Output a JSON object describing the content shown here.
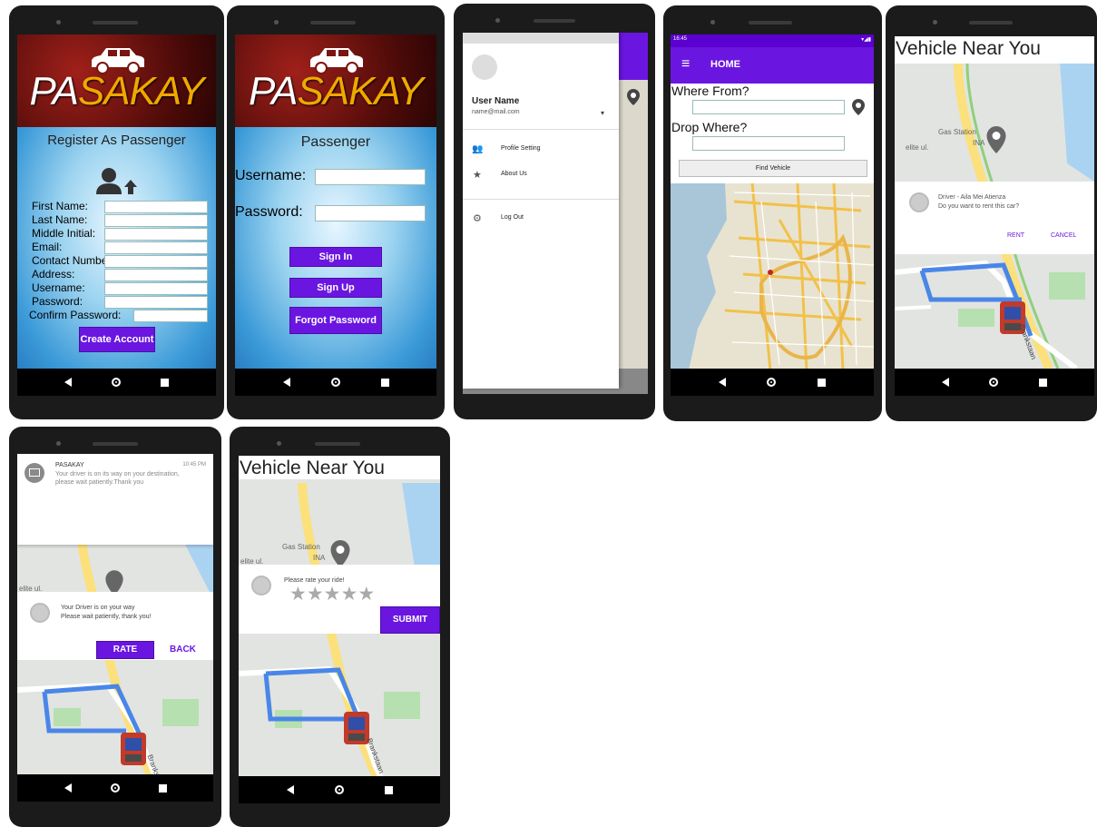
{
  "colors": {
    "accent": "#6a16e0",
    "purple_bar": "#6200ee",
    "gold": "#f0a800"
  },
  "brand": {
    "logo_part1": "PA",
    "logo_part2": "SAKAY"
  },
  "register": {
    "title": "Register As Passenger",
    "fields": [
      "First Name:",
      "Last Name:",
      "Middle Initial:",
      "Email:",
      "Contact Number:",
      "Address:",
      "Username:",
      "Password:",
      "Confirm Password:"
    ],
    "create_button": "Create Account"
  },
  "login": {
    "title": "Passenger",
    "username_label": "Username:",
    "password_label": "Password:",
    "sign_in": "Sign In",
    "sign_up": "Sign Up",
    "forgot": "Forgot Password"
  },
  "drawer": {
    "user_name": "User Name",
    "email": "name@mail.com",
    "items": [
      {
        "label": "Profile Setting",
        "icon": "people-icon"
      },
      {
        "label": "About Us",
        "icon": "star-icon"
      },
      {
        "label": "Log Out",
        "icon": "gear-icon"
      }
    ]
  },
  "home": {
    "status_time": "16:45",
    "title": "HOME",
    "where_from": "Where From?",
    "drop_where": "Drop Where?",
    "find_button": "Find Vehicle"
  },
  "vehicle": {
    "title": "Vehicle Near You",
    "driver_line": "Driver - Aila Mei Atienza",
    "question": "Do you want to rent this car?",
    "rent": "RENT",
    "cancel": "CANCEL",
    "map_labels": {
      "gas": "Gas Station",
      "ina": "INA",
      "street": "elite ul.",
      "road": "Brankstaan"
    }
  },
  "notification": {
    "app": "PASAKAY",
    "time": "10:45 PM",
    "text": "Your driver is on its way on your destination, please wait patiently.Thank you",
    "dialog_line1": "Your Driver is on your way",
    "dialog_line2": "Please wait patiently, thank you!",
    "rate": "RATE",
    "back": "BACK"
  },
  "rating": {
    "title": "Vehicle Near You",
    "prompt": "Please rate your ride!",
    "submit": "SUBMIT",
    "stars": 5,
    "rating_value": 0
  }
}
